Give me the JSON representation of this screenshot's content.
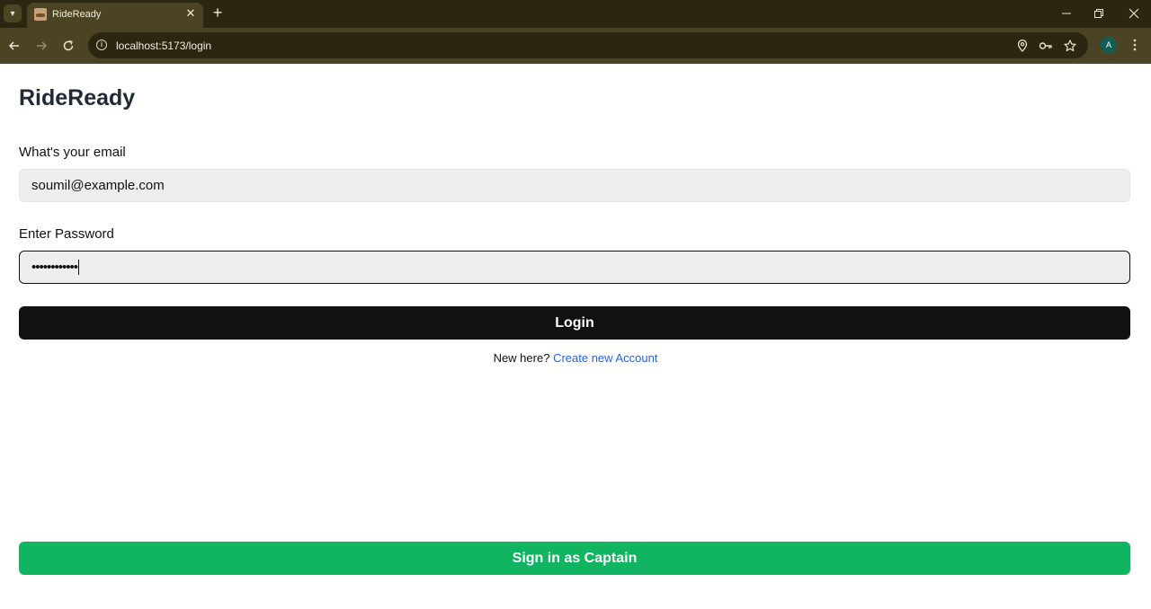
{
  "browser": {
    "tab_title": "RideReady",
    "url": "localhost:5173/login",
    "profile_initial": "A"
  },
  "page": {
    "brand": "RideReady",
    "email_label": "What's your email",
    "email_value": "soumil@example.com",
    "password_label": "Enter Password",
    "password_value": "••••••••••••",
    "login_button": "Login",
    "signup_prompt": "New here?",
    "signup_link": "Create new Account",
    "captain_button": "Sign in as Captain"
  },
  "colors": {
    "accent_green": "#10b461",
    "link_blue": "#2563eb",
    "login_black": "#111111"
  }
}
